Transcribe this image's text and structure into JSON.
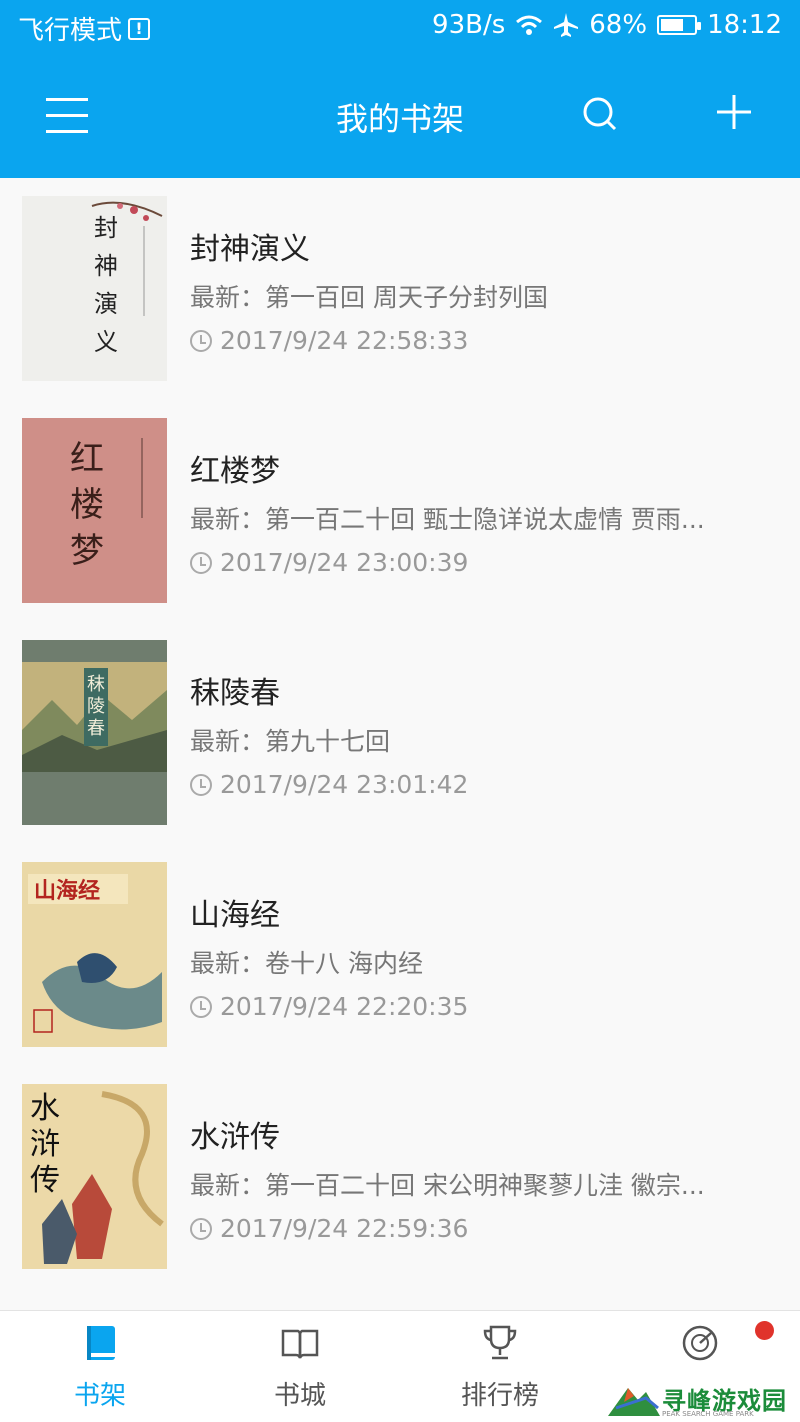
{
  "status_bar": {
    "mode": "飞行模式",
    "speed": "93B/s",
    "battery": "68%",
    "battery_level": 0.68,
    "time": "18:12"
  },
  "header": {
    "title": "我的书架",
    "menu_icon": "menu-icon",
    "search_icon": "search-icon",
    "add_icon": "plus-icon"
  },
  "books": [
    {
      "name": "封神演义",
      "latest": "最新：第一百回 周天子分封列国",
      "time": "2017/9/24 22:58:33",
      "cover_text": "封神演义"
    },
    {
      "name": "红楼梦",
      "latest": "最新：第一百二十回 甄士隐详说太虚情 贾雨...",
      "time": "2017/9/24 23:00:39",
      "cover_text": "红楼梦"
    },
    {
      "name": "秣陵春",
      "latest": "最新：第九十七回",
      "time": "2017/9/24 23:01:42",
      "cover_text": "秣陵春"
    },
    {
      "name": "山海经",
      "latest": "最新：卷十八 海内经",
      "time": "2017/9/24 22:20:35",
      "cover_text": "山海经"
    },
    {
      "name": "水浒传",
      "latest": "最新：第一百二十回 宋公明神聚蓼儿洼 徽宗...",
      "time": "2017/9/24 22:59:36",
      "cover_text": "水浒传"
    }
  ],
  "bottom_nav": [
    {
      "label": "书架",
      "icon": "book-icon",
      "active": true
    },
    {
      "label": "书城",
      "icon": "open-book-icon",
      "active": false
    },
    {
      "label": "排行榜",
      "icon": "trophy-icon",
      "active": false
    },
    {
      "label": "",
      "icon": "radar-icon",
      "active": false
    }
  ],
  "colors": {
    "accent": "#0aa5ef",
    "badge": "#e0332b"
  },
  "watermark": {
    "text": "寻峰游戏园",
    "sub": "PEAK SEARCH GAME PARK"
  }
}
